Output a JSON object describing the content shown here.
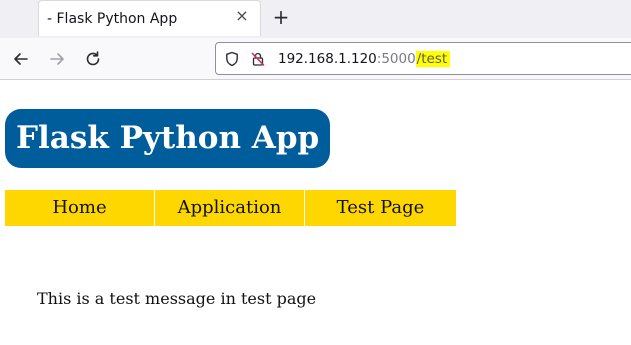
{
  "browser": {
    "tab": {
      "title": "- Flask Python App",
      "close_glyph": "×"
    },
    "new_tab_glyph": "+",
    "nav": {
      "back_icon": "arrow-left-icon",
      "forward_icon": "arrow-right-icon",
      "reload_icon": "reload-icon"
    },
    "url": {
      "host": "192.168.1.120",
      "port": ":5000",
      "path": "/test",
      "path_highlight_color": "#ffff00"
    }
  },
  "page": {
    "title": "Flask Python App",
    "title_bg_color": "#005d9c",
    "menu_color": "#ffd700",
    "menu": [
      {
        "label": "Home"
      },
      {
        "label": "Application"
      },
      {
        "label": "Test Page"
      }
    ],
    "message": "This is a test message in test page"
  }
}
